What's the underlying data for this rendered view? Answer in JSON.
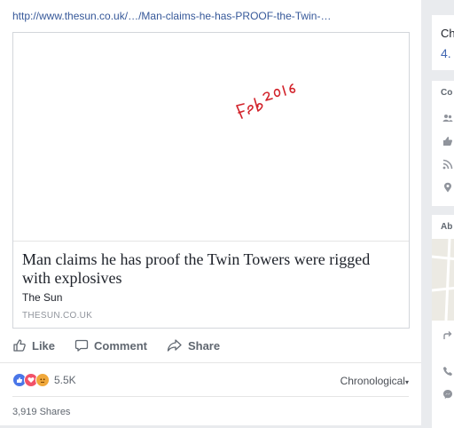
{
  "post": {
    "link": "http://www.thesun.co.uk/…/Man-claims-he-has-PROOF-the-Twin-…",
    "handwriting": "Feb 2016",
    "card": {
      "title": "Man claims he has proof the Twin Towers were rigged with explosives",
      "site": "The Sun",
      "domain": "THESUN.CO.UK"
    },
    "actions": {
      "like": "Like",
      "comment": "Comment",
      "share": "Share"
    },
    "reactions": {
      "count": "5.5K"
    },
    "order": "Chronological",
    "shares": "3,919 Shares"
  },
  "sidebar": {
    "card1_title": "Ch",
    "card1_value": "4.",
    "card2_heading": "Co",
    "card3_heading": "Ab"
  },
  "colors": {
    "link": "#365899",
    "like": "#4a76e8",
    "love": "#f25268",
    "angry": "#f0a83b",
    "ink": "#d2222a"
  }
}
